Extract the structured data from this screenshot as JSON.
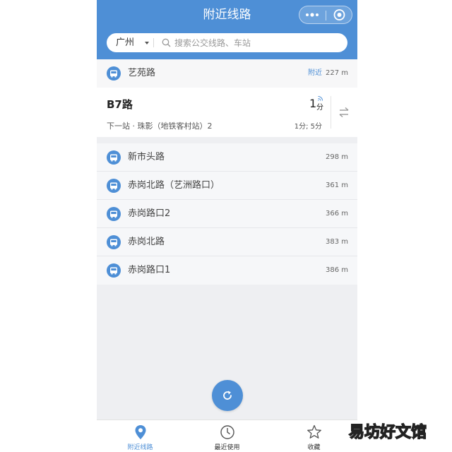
{
  "header": {
    "title": "附近线路",
    "more_icon": "more-dots-icon",
    "close_icon": "target-close-icon",
    "color": "#4e8fd6"
  },
  "search": {
    "city": "广州",
    "placeholder": "搜索公交线路、车站"
  },
  "nearest_station": {
    "name": "艺苑路",
    "tag": "附近",
    "distance": "227 m"
  },
  "route_card": {
    "route": "B7路",
    "next_stop": "下一站 · 珠影（地铁客村站）2",
    "eta_value": "1",
    "eta_unit": "分",
    "eta_list": "1分; 5分"
  },
  "stations": [
    {
      "name": "新市头路",
      "distance": "298 m"
    },
    {
      "name": "赤岗北路（艺洲路口）",
      "distance": "361 m"
    },
    {
      "name": "赤岗路口2",
      "distance": "366 m"
    },
    {
      "name": "赤岗北路",
      "distance": "383 m"
    },
    {
      "name": "赤岗路口1",
      "distance": "386 m"
    }
  ],
  "tabs": [
    {
      "label": "附近线路",
      "icon": "location-pin-icon",
      "active": true
    },
    {
      "label": "最近使用",
      "icon": "clock-icon",
      "active": false
    },
    {
      "label": "收藏",
      "icon": "star-icon",
      "active": false
    }
  ],
  "watermark": "易坊好文馆"
}
